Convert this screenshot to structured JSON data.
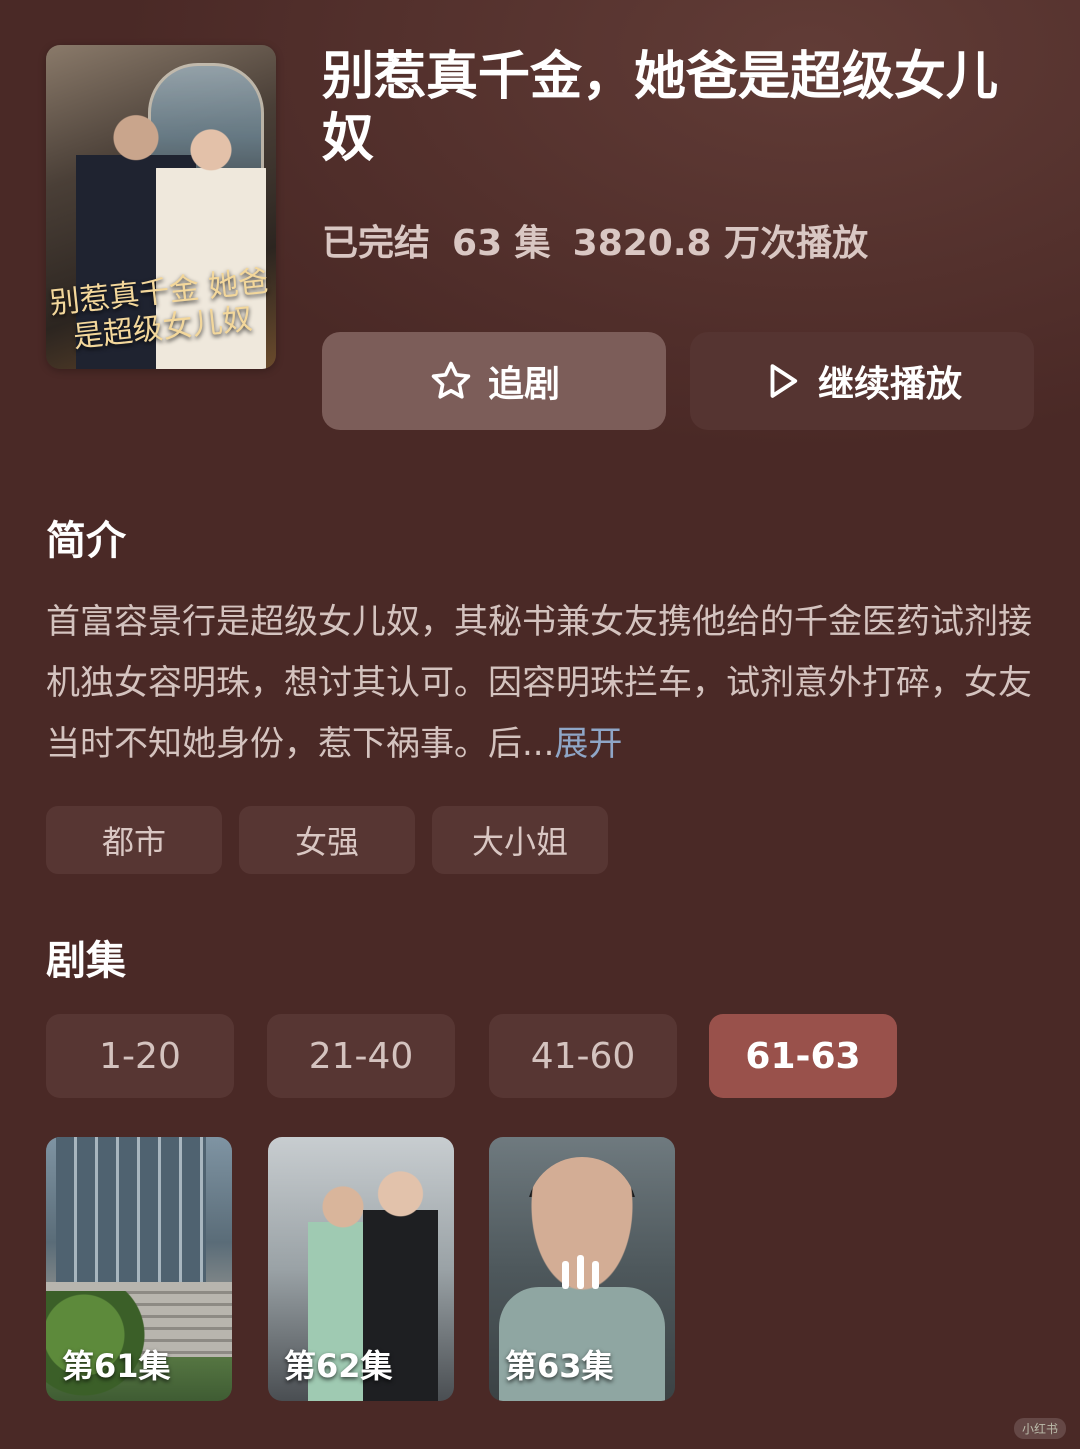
{
  "show": {
    "title": "别惹真千金，她爸是超级女儿奴",
    "poster_title_art": "别惹真千金 她爸是超级女儿奴",
    "status": "已完结",
    "episode_count": "63 集",
    "plays": "3820.8 万次播放"
  },
  "actions": {
    "follow_label": "追剧",
    "follow_icon": "star-icon",
    "play_label": "继续播放",
    "play_icon": "play-icon"
  },
  "intro": {
    "heading": "简介",
    "text": "首富容景行是超级女儿奴，其秘书兼女友携他给的千金医药试剂接机独女容明珠，想讨其认可。因容明珠拦车，试剂意外打碎，女友当时不知她身份，惹下祸事。后...",
    "expand_label": "展开"
  },
  "tags": [
    "都市",
    "女强",
    "大小姐"
  ],
  "episodes": {
    "heading": "剧集",
    "ranges": [
      {
        "label": "1-20",
        "active": false
      },
      {
        "label": "21-40",
        "active": false
      },
      {
        "label": "41-60",
        "active": false
      },
      {
        "label": "61-63",
        "active": true
      }
    ],
    "items": [
      {
        "prefix": "第",
        "number": "61",
        "suffix": "集",
        "playing": false
      },
      {
        "prefix": "第",
        "number": "62",
        "suffix": "集",
        "playing": false
      },
      {
        "prefix": "第",
        "number": "63",
        "suffix": "集",
        "playing": true
      }
    ]
  },
  "watermark": "小红书",
  "colors": {
    "background": "#4a2926",
    "active_range": "#99514b",
    "expand_link": "#8fa6c7"
  }
}
